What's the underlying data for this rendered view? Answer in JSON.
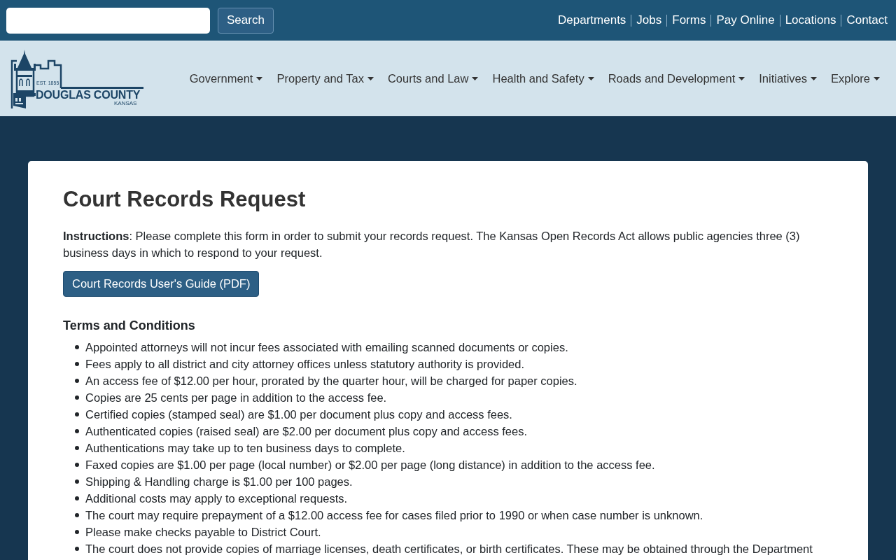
{
  "top_bar": {
    "search_button": "Search",
    "links": [
      "Departments",
      "Jobs",
      "Forms",
      "Pay Online",
      "Locations",
      "Contact"
    ]
  },
  "logo": {
    "established": "EST. 1855",
    "name": "DOUGLAS COUNTY",
    "state": "KANSAS"
  },
  "nav": [
    {
      "label": "Government",
      "has_menu": true
    },
    {
      "label": "Property and Tax",
      "has_menu": true
    },
    {
      "label": "Courts and Law",
      "has_menu": true
    },
    {
      "label": "Health and Safety",
      "has_menu": true
    },
    {
      "label": "Roads and Development",
      "has_menu": true
    },
    {
      "label": "Initiatives",
      "has_menu": true
    },
    {
      "label": "Explore",
      "has_menu": true
    }
  ],
  "page": {
    "title": "Court Records Request",
    "instructions": "**Instructions**: Please complete this form in order to submit your records request. The Kansas Open Records Act allows public agencies three (3) business days in which to respond to your request.",
    "guide_button": "Court Records User's Guide (PDF)",
    "terms_heading": "Terms and Conditions",
    "terms": [
      "Appointed attorneys will not incur fees associated with emailing scanned documents or copies.",
      "Fees apply to all district and city attorney offices unless statutory authority is provided.",
      "An access fee of $12.00 per hour, prorated by the quarter hour, will be charged for paper copies.",
      "Copies are 25 cents per page in addition to the access fee.",
      "Certified copies (stamped seal) are $1.00 per document plus copy and access fees.",
      "Authenticated copies (raised seal) are $2.00 per document plus copy and access fees.",
      "Authentications may take up to ten business days to complete.",
      "Faxed copies are $1.00 per page (local number) or $2.00 per page (long distance) in addition to the access fee.",
      "Shipping & Handling charge is $1.00 per 100 pages.",
      "Additional costs may apply to exceptional requests.",
      "The court may require prepayment of a $12.00 access fee for cases filed prior to 1990 or when case number is unknown.",
      "Please make checks payable to District Court.",
      "The court does not provide copies of marriage licenses, death certificates, or birth certificates. These may be obtained through the Department"
    ]
  }
}
